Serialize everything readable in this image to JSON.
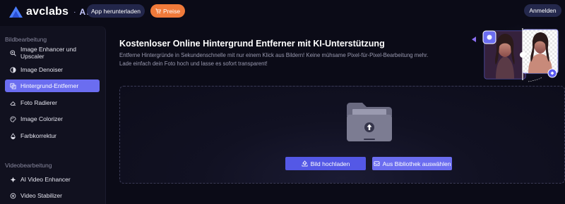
{
  "header": {
    "logo_text": "avclabs",
    "logo_separator": "·",
    "logo_suffix": "AI",
    "download_label": "App herunterladen",
    "price_label": "Preise",
    "login_label": "Anmelden"
  },
  "sidebar": {
    "section1_title": "Bildbearbeitung",
    "items": [
      {
        "label": "Image Enhancer und Upscaler",
        "icon": "zoom-plus-icon"
      },
      {
        "label": "Image Denoiser",
        "icon": "denoise-icon"
      },
      {
        "label": "Hintergrund-Entferner",
        "icon": "background-remove-icon",
        "active": true
      },
      {
        "label": "Foto Radierer",
        "icon": "eraser-icon"
      },
      {
        "label": "Image Colorizer",
        "icon": "palette-icon"
      },
      {
        "label": "Farbkorrektur",
        "icon": "color-drop-icon"
      }
    ],
    "section2_title": "Videobearbeitung",
    "video_items": [
      {
        "label": "AI Video Enhancer",
        "icon": "video-enhance-icon"
      },
      {
        "label": "Video Stabilizer",
        "icon": "video-stabilize-icon"
      }
    ]
  },
  "main": {
    "title": "Kostenloser Online Hintergrund Entferner mit KI-Unterstützung",
    "description": "Entferne Hintergründe in Sekundenschnelle mit nur einem Klick aus Bildern! Keine mühsame Pixel-für-Pixel-Bearbeitung mehr. Lade einfach dein Foto hoch und lasse es sofort transparent!",
    "upload_label": "Bild hochladen",
    "library_label": "Aus Bibliothek auswählen"
  },
  "colors": {
    "accent": "#6b6df0",
    "price": "#f07a3a",
    "background": "#0b0b17"
  }
}
